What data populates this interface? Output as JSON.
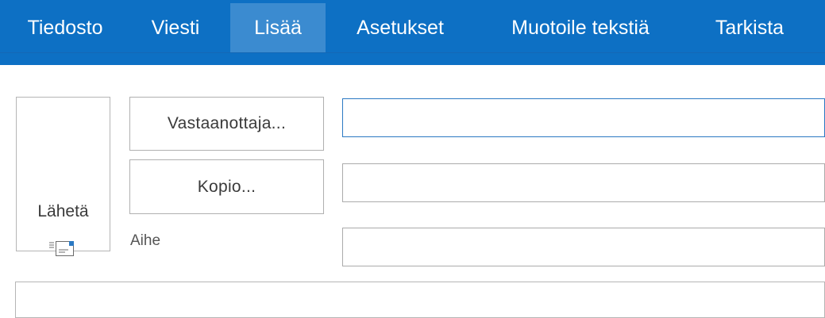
{
  "ribbon": {
    "tabs": [
      {
        "label": "Tiedosto"
      },
      {
        "label": "Viesti"
      },
      {
        "label": "Lisää"
      },
      {
        "label": "Asetukset"
      },
      {
        "label": "Muotoile tekstiä"
      },
      {
        "label": "Tarkista"
      }
    ],
    "active_tab": "Lisää",
    "color": "#0d70c4"
  },
  "compose": {
    "send_label": "Lähetä",
    "send_icon": "envelope-send-icon",
    "to_button_label": "Vastaanottaja...",
    "cc_button_label": "Kopio...",
    "subject_label": "Aihe",
    "to_value": "",
    "cc_value": "",
    "subject_value": "",
    "body_value": ""
  }
}
